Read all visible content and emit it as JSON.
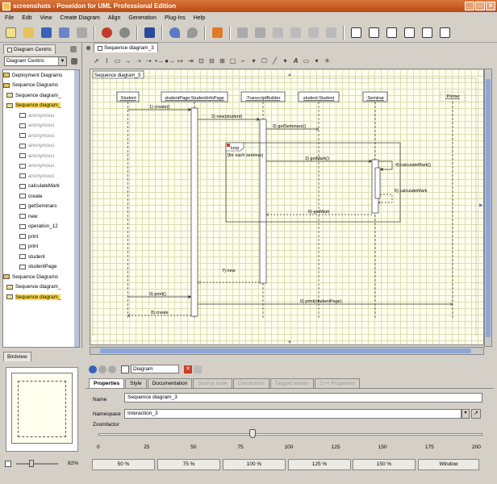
{
  "app": {
    "title": "screenshots - Poseidon for UML Professional Edition",
    "window_buttons": [
      "_",
      "□",
      "✕"
    ]
  },
  "menu": [
    "File",
    "Edit",
    "View",
    "Create Diagram",
    "Align",
    "Generation",
    "Plug-Ins",
    "Help"
  ],
  "left": {
    "tab_label": "Diagram Centric",
    "combo_value": "Diagram Centric",
    "tree": [
      {
        "label": "Deployment Diagrams",
        "style": "normal"
      },
      {
        "label": "Sequence Diagrams",
        "style": "normal"
      },
      {
        "label": "Sequence diagram_",
        "style": "normal"
      },
      {
        "label": "Sequence diagram_",
        "style": "selected"
      },
      {
        "label": "anonymous",
        "style": "gray"
      },
      {
        "label": "anonymous",
        "style": "gray"
      },
      {
        "label": "anonymous",
        "style": "gray"
      },
      {
        "label": "anonymous",
        "style": "gray"
      },
      {
        "label": "anonymous",
        "style": "gray"
      },
      {
        "label": "anonymous",
        "style": "gray"
      },
      {
        "label": "anonymous",
        "style": "gray"
      },
      {
        "label": "calculateMark",
        "style": "normal"
      },
      {
        "label": "create",
        "style": "normal"
      },
      {
        "label": "getSeminars",
        "style": "normal"
      },
      {
        "label": "new",
        "style": "normal"
      },
      {
        "label": "operation_12",
        "style": "normal"
      },
      {
        "label": "print",
        "style": "normal"
      },
      {
        "label": "print",
        "style": "normal"
      },
      {
        "label": "student",
        "style": "normal"
      },
      {
        "label": "studentPage",
        "style": "normal"
      },
      {
        "label": "Sequence Diagrams",
        "style": "normal"
      },
      {
        "label": "Sequence diagram_",
        "style": "normal"
      },
      {
        "label": "Sequence diagram_",
        "style": "selected"
      }
    ],
    "birdview_label": "Birdview",
    "zoom_percent": "82%"
  },
  "diagram": {
    "tab_label": "Sequence diagram_3",
    "frame_label": "Sequence diagram_3",
    "lifelines": [
      ":Student",
      "studentPage:StudentInfoPage",
      ":TranscriptBuilder",
      "student:Student",
      ":Seminar",
      ":Printer"
    ],
    "loop_label": "loop",
    "loop_guard": "[for each seminar]",
    "messages": [
      "1) create()",
      "2) new(student)",
      "0) getSeminars()",
      "3) getMark()",
      "4) calculateMark()",
      "5) calculateMark",
      "6) getMark",
      "7) new",
      "0) print()",
      "0) print(studentPage)",
      "8) create"
    ]
  },
  "properties": {
    "header": "Diagram",
    "tabs": [
      "Properties",
      "Style",
      "Documentation",
      "Source code",
      "Constraints",
      "Tagged Values",
      "C++ Properties"
    ],
    "name_label": "Name",
    "name_value": "Sequence diagram_3",
    "namespace_label": "Namespace",
    "namespace_value": "Interaction_3",
    "zoom_label": "Zoomfactor",
    "scale": [
      "0",
      "25",
      "50",
      "75",
      "100",
      "125",
      "150",
      "175",
      "200"
    ],
    "slider_value": 100,
    "zoom_buttons": [
      "50 %",
      "75 %",
      "100 %",
      "125 %",
      "150 %",
      "Window"
    ]
  }
}
